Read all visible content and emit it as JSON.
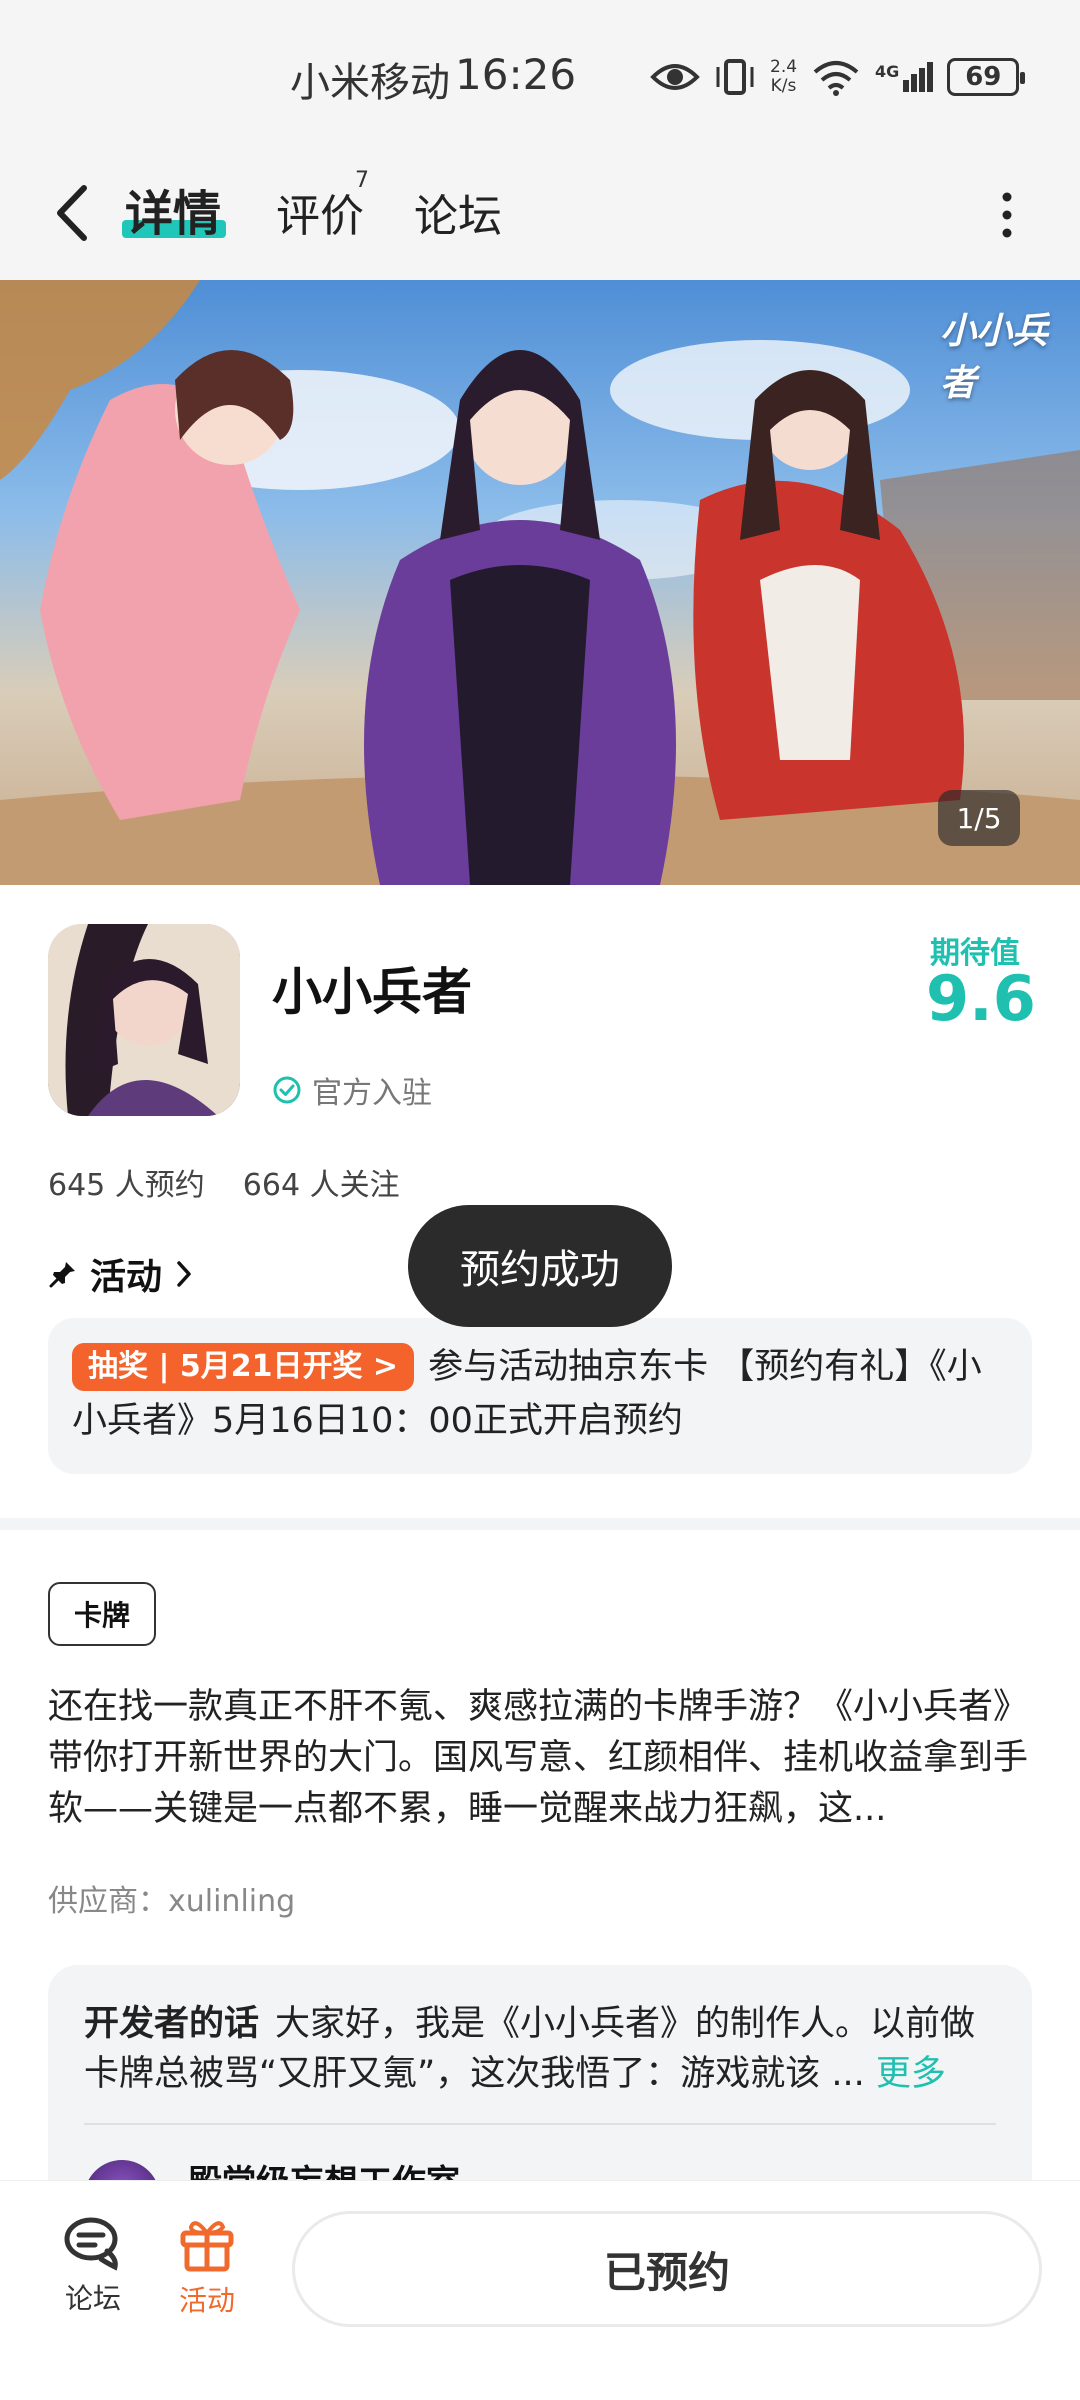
{
  "status_bar": {
    "carrier": "小米移动",
    "time": "16:26",
    "net_speed_value": "2.4",
    "net_speed_unit": "K/s",
    "signal_type": "4G",
    "battery": "69"
  },
  "header": {
    "tabs": [
      {
        "label": "详情",
        "active": true
      },
      {
        "label": "评价",
        "count": "7"
      },
      {
        "label": "论坛"
      }
    ]
  },
  "banner": {
    "logo_text": "小小兵者",
    "counter": "1/5"
  },
  "game": {
    "title": "小小兵者",
    "official_label": "官方入驻",
    "expect_label": "期待值",
    "expect_value": "9.6",
    "reservations": "645 人预约",
    "followers": "664 人关注"
  },
  "activity": {
    "header": "活动",
    "toast": "预约成功",
    "badge": "抽奖 | 5月21日开奖 >",
    "text": "参与活动抽京东卡 【预约有礼】《小小兵者》5月16日10：00正式开启预约"
  },
  "description": {
    "tag": "卡牌",
    "text": "还在找一款真正不肝不氪、爽感拉满的卡牌手游？《小小兵者》带你打开新世界的大门。国风写意、红颜相伴、挂机收益拿到手软——关键是一点都不累，睡一觉醒来战力狂飙，这...",
    "supplier": "供应商：xulinling"
  },
  "developer": {
    "title": "开发者的话",
    "text": "大家好，我是《小小兵者》的制作人。以前做卡牌总被骂“又肝又氪”，这次我悟了：游戏就该 ...",
    "more": "更多",
    "studio": "殿堂级妄想工作室"
  },
  "bottom_bar": {
    "forum_label": "论坛",
    "activity_label": "活动",
    "reserve_button": "已预约"
  },
  "colors": {
    "accent": "#1fc0b0",
    "activity_orange": "#f06a2d",
    "badge_orange": "#f4632b",
    "toast_bg": "#2b2b2b"
  }
}
